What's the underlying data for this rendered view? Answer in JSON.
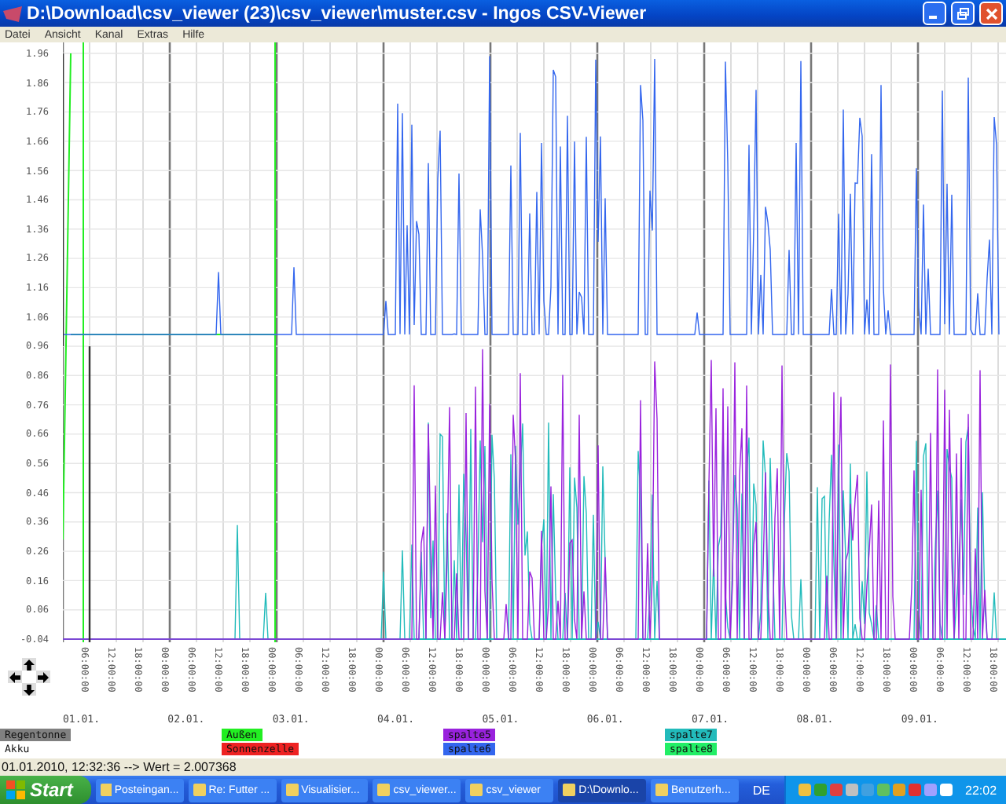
{
  "window": {
    "title": "D:\\Download\\csv_viewer (23)\\csv_viewer\\muster.csv - Ingos CSV-Viewer"
  },
  "menu": [
    "Datei",
    "Ansicht",
    "Kanal",
    "Extras",
    "Hilfe"
  ],
  "chart": {
    "y_labels": [
      "1.96",
      "1.86",
      "1.76",
      "1.66",
      "1.56",
      "1.46",
      "1.36",
      "1.26",
      "1.16",
      "1.06",
      "0.96",
      "0.86",
      "0.76",
      "0.66",
      "0.56",
      "0.46",
      "0.36",
      "0.26",
      "0.16",
      "0.06",
      "-0.04"
    ],
    "x_labels": [
      "06:00:00",
      "12:00:00",
      "18:00:00",
      "00:00:00",
      "06:00:00",
      "12:00:00",
      "18:00:00",
      "00:00:00",
      "06:00:00",
      "12:00:00",
      "18:00:00",
      "00:00:00",
      "06:00:00",
      "12:00:00",
      "18:00:00",
      "00:00:00",
      "06:00:00",
      "12:00:00",
      "18:00:00",
      "00:00:00",
      "06:00:00",
      "12:00:00",
      "18:00:00",
      "00:00:00",
      "06:00:00",
      "12:00:00",
      "18:00:00",
      "00:00:00",
      "06:00:00",
      "12:00:00",
      "18:00:00",
      "00:00:00",
      "06:00:00",
      "12:00:00",
      "18:00:00"
    ],
    "dates": [
      "01.01.",
      "02.01.",
      "03.01.",
      "04.01.",
      "05.01.",
      "06.01.",
      "07.01.",
      "08.01.",
      "09.01."
    ]
  },
  "series": [
    {
      "name": "Regentonne",
      "color": "#808080"
    },
    {
      "name": "Akku",
      "color": "#ffffff"
    },
    {
      "name": "Außen",
      "color": "#22ee22"
    },
    {
      "name": "Sonnenzelle",
      "color": "#ee2222"
    },
    {
      "name": "spalte5",
      "color": "#9922dd"
    },
    {
      "name": "spalte6",
      "color": "#3366ee"
    },
    {
      "name": "spalte7",
      "color": "#22bbbb"
    },
    {
      "name": "spalte8",
      "color": "#22ee66"
    }
  ],
  "status": "01.01.2010, 12:32:36 --> Wert = 2.007368",
  "taskbar": {
    "start": "Start",
    "tasks": [
      {
        "label": "Posteingan...",
        "selected": false
      },
      {
        "label": "Re: Futter ...",
        "selected": false
      },
      {
        "label": "Visualisier...",
        "selected": false
      },
      {
        "label": "csv_viewer...",
        "selected": false
      },
      {
        "label": "csv_viewer",
        "selected": false
      },
      {
        "label": "D:\\Downlo...",
        "selected": true
      },
      {
        "label": "Benutzerh...",
        "selected": false
      }
    ],
    "language": "DE",
    "clock": "22:02"
  }
}
